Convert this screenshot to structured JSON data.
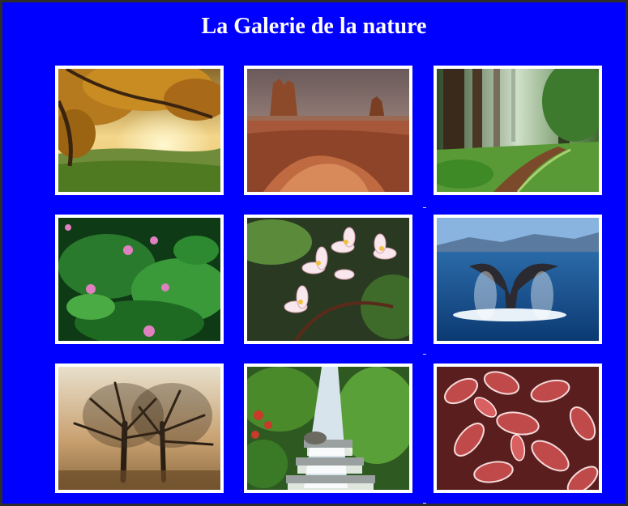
{
  "page": {
    "title": "La Galerie de la nature",
    "background_color": "#0000ff",
    "frame_color": "#ffffff"
  },
  "gallery": {
    "photos": [
      {
        "subject": "autumn tree over green meadow at sunset"
      },
      {
        "subject": "desert buttes in monument valley"
      },
      {
        "subject": "redwood forest with dirt path"
      },
      {
        "subject": "pink wildflowers with green leaves"
      },
      {
        "subject": "white and pink plumeria flowers"
      },
      {
        "subject": "whale tail above the ocean"
      },
      {
        "subject": "bare trees in misty sunrise"
      },
      {
        "subject": "waterfall cascade in tropical garden"
      },
      {
        "subject": "frosted red leaves"
      }
    ]
  }
}
